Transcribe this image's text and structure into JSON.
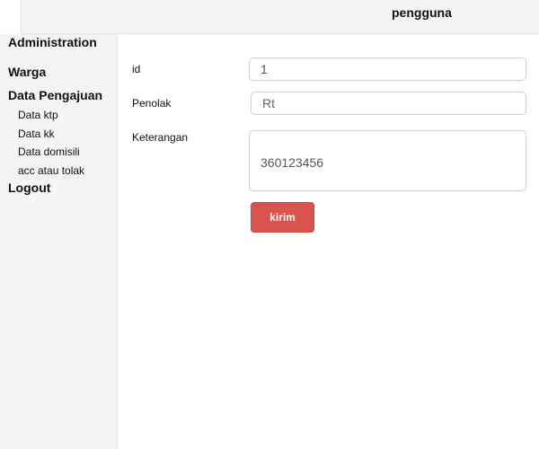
{
  "header": {
    "title": "pengguna"
  },
  "sidebar": {
    "items": [
      {
        "label": "Administration"
      },
      {
        "label": "Warga"
      },
      {
        "label": "Data Pengajuan",
        "children": [
          {
            "label": "Data ktp"
          },
          {
            "label": "Data kk"
          },
          {
            "label": "Data domisili"
          },
          {
            "label": "acc atau tolak"
          }
        ]
      },
      {
        "label": "Logout"
      }
    ]
  },
  "form": {
    "id": {
      "label": "id",
      "value": "1"
    },
    "penolak": {
      "label": "Penolak",
      "placeholder": "Rt"
    },
    "keterangan": {
      "label": "Keterangan",
      "value": "360123456"
    },
    "submit_label": "kirim"
  },
  "colors": {
    "submit_button": "#d9534f",
    "sidebar_bg": "#f4f4f4"
  }
}
